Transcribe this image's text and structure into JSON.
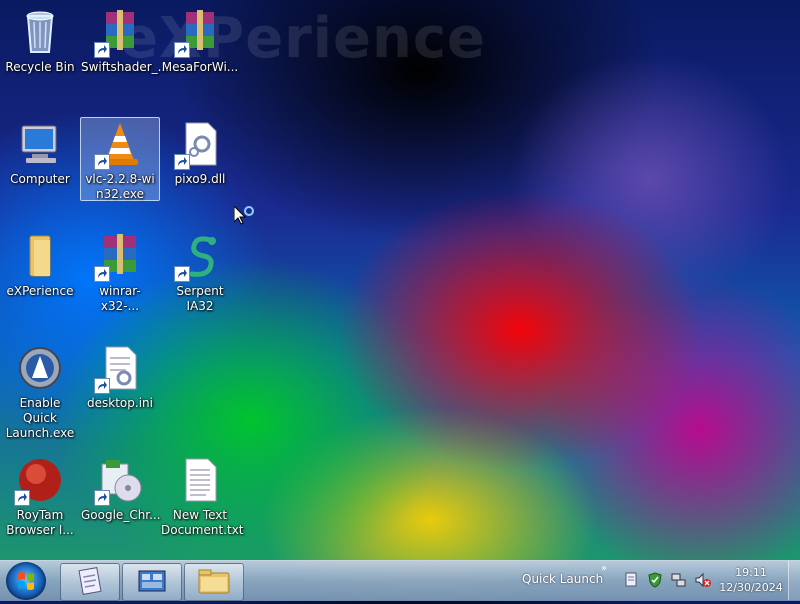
{
  "wallpaper": {
    "watermark": "eXPerience"
  },
  "desktop": {
    "icons": [
      {
        "label": "Recycle Bin"
      },
      {
        "label": "Swiftshader_..."
      },
      {
        "label": "MesaForWi..."
      },
      {
        "label": "Computer"
      },
      {
        "label": "vlc-2.2.8-win32.exe"
      },
      {
        "label": "pixo9.dll"
      },
      {
        "label": "eXPerience"
      },
      {
        "label": "winrar-x32-..."
      },
      {
        "label": "Serpent IA32"
      },
      {
        "label": "Enable Quick Launch.exe"
      },
      {
        "label": "desktop.ini"
      },
      {
        "label": "RoyTam Browser I..."
      },
      {
        "label": "Google_Chr..."
      },
      {
        "label": "New Text Document.txt"
      }
    ]
  },
  "taskbar": {
    "quick_launch_label": "Quick Launch",
    "chevron": "»",
    "clock": {
      "time": "19:11",
      "date": "12/30/2024"
    },
    "colors": {
      "start_orb": "#1f6fc8",
      "bar": "#8ca5c3"
    }
  }
}
